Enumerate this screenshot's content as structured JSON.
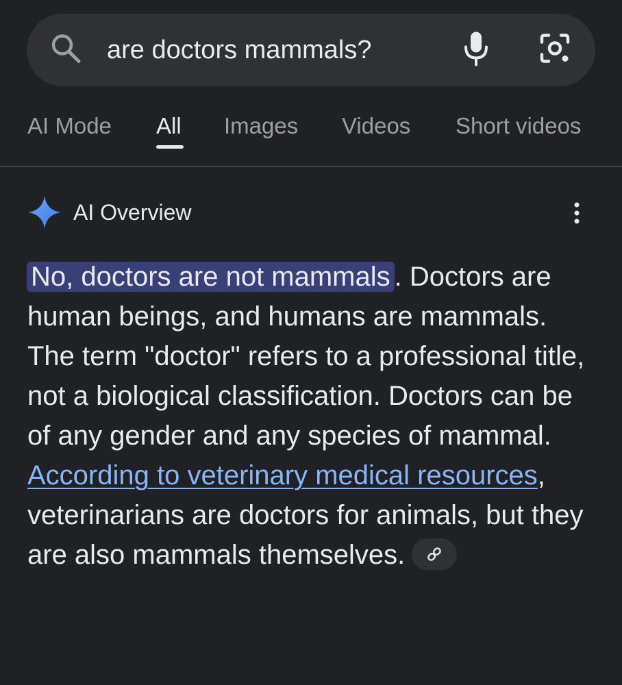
{
  "search": {
    "query": "are doctors mammals?"
  },
  "icons": {
    "search": "search-icon",
    "mic": "mic-icon",
    "lens": "google-lens-icon",
    "sparkle": "sparkle-icon",
    "more": "more-vertical-icon",
    "link": "link-icon"
  },
  "tabs": [
    {
      "label": "AI Mode",
      "active": false
    },
    {
      "label": "All",
      "active": true
    },
    {
      "label": "Images",
      "active": false
    },
    {
      "label": "Videos",
      "active": false
    },
    {
      "label": "Short videos",
      "active": false
    }
  ],
  "ai_overview": {
    "title": "AI Overview",
    "highlighted": "No, doctors are not mammals",
    "text_1": ". Doctors are human beings, and humans are mammals. The term \"doctor\" refers to a professional title, not a biological classification. Doctors can be of any gender and any species of mammal. ",
    "link_text": "According to veterinary medical resources",
    "text_2": ", veterinarians are doctors for animals, but they are also mammals themselves."
  },
  "colors": {
    "background": "#202124",
    "search_bar": "#303134",
    "text": "#e8eaed",
    "muted": "#9aa0a6",
    "link": "#8ab4f8",
    "highlight": "#394078",
    "sparkle": "#4c8df6"
  }
}
